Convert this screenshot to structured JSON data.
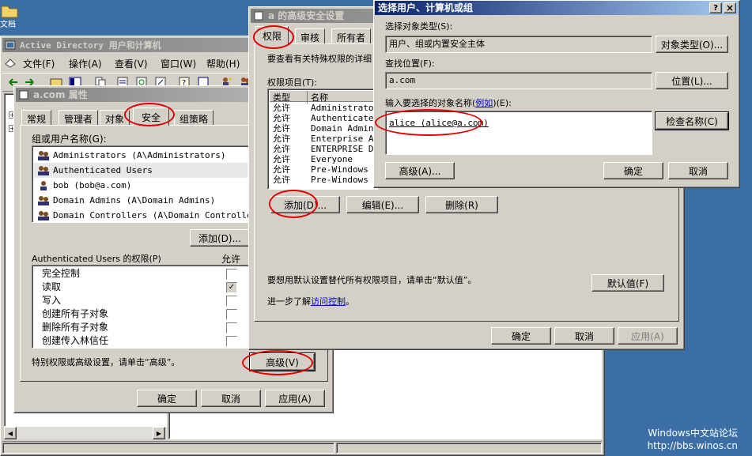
{
  "desktop": {
    "icon_label": "文档",
    "watermark_line1": "Windows中文站论坛",
    "watermark_line2": "http://bbs.winos.cn"
  },
  "ad_window": {
    "title": "Active Directory 用户和计算机",
    "menu": [
      "文件(F)",
      "操作(A)",
      "查看(V)",
      "窗口(W)",
      "帮助(H)"
    ]
  },
  "props": {
    "title": "a.com 属性",
    "tabs": [
      "常规",
      "管理者",
      "对象",
      "安全",
      "组策略"
    ],
    "group_label": "组或用户名称(G):",
    "users": [
      "Administrators (A\\Administrators)",
      "Authenticated Users",
      "bob (bob@a.com)",
      "Domain Admins (A\\Domain Admins)",
      "Domain Controllers (A\\Domain Controllers)"
    ],
    "add_button": "添加(D)...",
    "perm_label": "Authenticated Users 的权限(P)",
    "allow_header": "允许",
    "perms": [
      {
        "name": "完全控制",
        "checked": ""
      },
      {
        "name": "读取",
        "checked": "✓"
      },
      {
        "name": "写入",
        "checked": ""
      },
      {
        "name": "创建所有子对象",
        "checked": ""
      },
      {
        "name": "删除所有子对象",
        "checked": ""
      },
      {
        "name": "创建传入林信任",
        "checked": ""
      }
    ],
    "advanced_text": "特别权限或高级设置，请单击“高级”。",
    "advanced_button": "高级(V)",
    "ok": "确定",
    "cancel": "取消",
    "apply": "应用(A)"
  },
  "adv": {
    "title": "a 的高级安全设置",
    "tabs": [
      "权限",
      "审核",
      "所有者"
    ],
    "desc": "要查看有关特殊权限的详细",
    "entries_label": "权限项目(T):",
    "col_type": "类型",
    "col_name": "名称",
    "entries": [
      {
        "type": "允许",
        "name": "Administrators"
      },
      {
        "type": "允许",
        "name": "Authenticated"
      },
      {
        "type": "允许",
        "name": "Domain Admins"
      },
      {
        "type": "允许",
        "name": "Enterprise Ad"
      },
      {
        "type": "允许",
        "name": "ENTERPRISE DO"
      },
      {
        "type": "允许",
        "name": "Everyone"
      },
      {
        "type": "允许",
        "name": "Pre-Windows 2"
      },
      {
        "type": "允许",
        "name": "Pre-Windows 2"
      }
    ],
    "add_button": "添加(D)...",
    "edit_button": "编辑(E)...",
    "remove_button": "删除(R)",
    "default_text": "要想用默认设置替代所有权限项目，请单击“默认值”。",
    "default_button": "默认值(F)",
    "learn_prefix": "进一步了解",
    "learn_link": "访问控制",
    "learn_suffix": "。",
    "ok": "确定",
    "cancel": "取消",
    "apply": "应用(A)"
  },
  "select": {
    "title": "选择用户、计算机或组",
    "obj_type_label": "选择对象类型(S):",
    "obj_type_value": "用户、组或内置安全主体",
    "obj_type_button": "对象类型(O)...",
    "location_label": "查找位置(F):",
    "location_value": "a.com",
    "location_button": "位置(L)...",
    "names_label_prefix": "输入要选择的对象名称(",
    "names_label_link": "例如",
    "names_label_suffix": ")(E):",
    "names_value": "alice (alice@a.com)",
    "check_button": "检查名称(C)",
    "advanced_button": "高级(A)...",
    "ok": "确定",
    "cancel": "取消",
    "help_glyph": "?",
    "close_glyph": "×"
  },
  "colors": {
    "desktop": "#3a6ea5",
    "title_active": "#0a246a",
    "title_inactive": "#808080",
    "annotation": "#e00000",
    "link": "#0000cc"
  }
}
